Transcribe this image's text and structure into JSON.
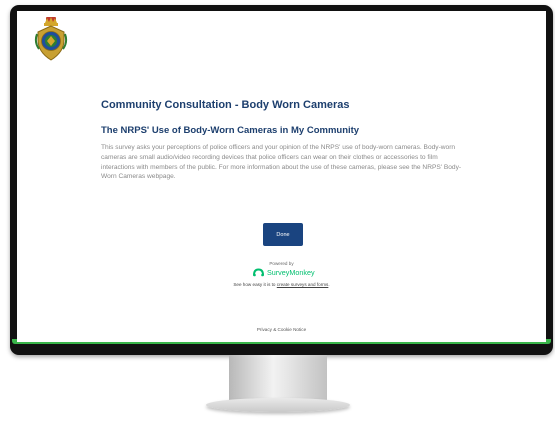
{
  "survey": {
    "title": "Community Consultation - Body Worn Cameras",
    "subtitle": "The NRPS' Use of Body-Worn Cameras in My Community",
    "description": "This survey asks your perceptions of police officers and your opinion of the NRPS' use of body-worn cameras. Body-worn cameras are small audio/video recording devices that police officers can wear on their clothes or accessories to film interactions with members of the public. For more information about the use of these cameras, please see the NRPS' Body-Worn Cameras webpage.",
    "done_label": "Done"
  },
  "footer": {
    "powered_by": "Powered by",
    "brand_name": "SurveyMonkey",
    "see_how_text": "See how easy it is to ",
    "see_how_link": "create surveys and forms",
    "see_how_end": ".",
    "privacy_label": "Privacy & Cookie Notice"
  },
  "colors": {
    "title_blue": "#1d3f6e",
    "button_blue": "#1a4480",
    "surveymonkey_green": "#00bf6f",
    "screen_accent_green": "#39b54a"
  },
  "icons": [
    "police-crest-logo",
    "surveymonkey-logo-icon"
  ]
}
